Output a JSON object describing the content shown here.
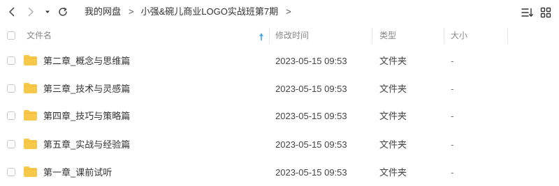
{
  "breadcrumb": {
    "root": "我的网盘",
    "separator": ">",
    "current": "小强&碗儿商业LOGO实战班第7期",
    "trailing_separator": ">"
  },
  "table": {
    "columns": {
      "name": "文件名",
      "modified": "修改时间",
      "type": "类型",
      "size": "大小"
    },
    "sort": {
      "column": "name",
      "direction": "asc"
    },
    "rows": [
      {
        "name": "第二章_概念与思维篇",
        "modified": "2023-05-15 09:53",
        "type": "文件夹",
        "size": "-"
      },
      {
        "name": "第三章_技术与灵感篇",
        "modified": "2023-05-15 09:53",
        "type": "文件夹",
        "size": "-"
      },
      {
        "name": "第四章_技巧与策略篇",
        "modified": "2023-05-15 09:53",
        "type": "文件夹",
        "size": "-"
      },
      {
        "name": "第五章_实战与经验篇",
        "modified": "2023-05-15 09:53",
        "type": "文件夹",
        "size": "-"
      },
      {
        "name": "第一章_课前试听",
        "modified": "2023-05-15 09:53",
        "type": "文件夹",
        "size": "-"
      }
    ]
  },
  "icons": {
    "back": "chevron-left-icon",
    "forward": "chevron-right-icon",
    "history": "caret-down-icon",
    "refresh": "refresh-icon",
    "sort_menu": "sort-list-icon",
    "grid_view": "grid-view-icon",
    "folder": "folder-icon"
  },
  "colors": {
    "folder": "#f7c84a",
    "sort_arrow": "#3aa0e8",
    "divider": "#e6e6e6"
  }
}
